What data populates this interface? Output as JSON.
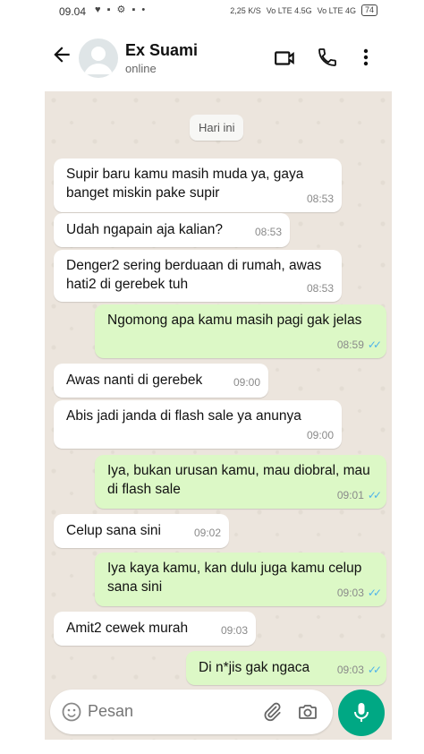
{
  "status_bar": {
    "time": "09.04",
    "left_icons": "♥ ▪ ⚙ ▪ •",
    "net_speed": "2,25 K/S",
    "signal1": "Vo LTE 4.5G",
    "signal2": "Vo LTE 4G",
    "battery": "74"
  },
  "header": {
    "contact_name": "Ex Suami",
    "presence": "online"
  },
  "chat": {
    "date_label": "Hari ini",
    "messages": [
      {
        "dir": "in",
        "text": "Supir baru kamu masih muda ya, gaya banget miskin pake supir",
        "time": "08:53"
      },
      {
        "dir": "in",
        "text": "Udah ngapain aja kalian?",
        "time": "08:53"
      },
      {
        "dir": "in",
        "text": "Denger2 sering berduaan di rumah, awas hati2 di gerebek tuh",
        "time": "08:53"
      },
      {
        "dir": "out",
        "text": "Ngomong apa kamu masih pagi gak jelas",
        "time": "08:59"
      },
      {
        "dir": "in",
        "text": "Awas nanti di gerebek",
        "time": "09:00"
      },
      {
        "dir": "in",
        "text": "Abis jadi janda di flash sale ya anunya",
        "time": "09:00"
      },
      {
        "dir": "out",
        "text": "Iya, bukan urusan kamu, mau diobral, mau di flash sale",
        "time": "09:01"
      },
      {
        "dir": "in",
        "text": "Celup sana sini",
        "time": "09:02"
      },
      {
        "dir": "out",
        "text": "Iya kaya kamu, kan dulu juga kamu celup sana sini",
        "time": "09:03"
      },
      {
        "dir": "in",
        "text": "Amit2 cewek murah",
        "time": "09:03"
      },
      {
        "dir": "out",
        "text": "Di n*jis gak ngaca",
        "time": "09:03"
      }
    ]
  },
  "composer": {
    "placeholder": "Pesan"
  },
  "colors": {
    "incoming": "#ffffff",
    "outgoing": "#dcf8c6",
    "accent": "#00a884",
    "read_ticks": "#4fb3ea"
  }
}
